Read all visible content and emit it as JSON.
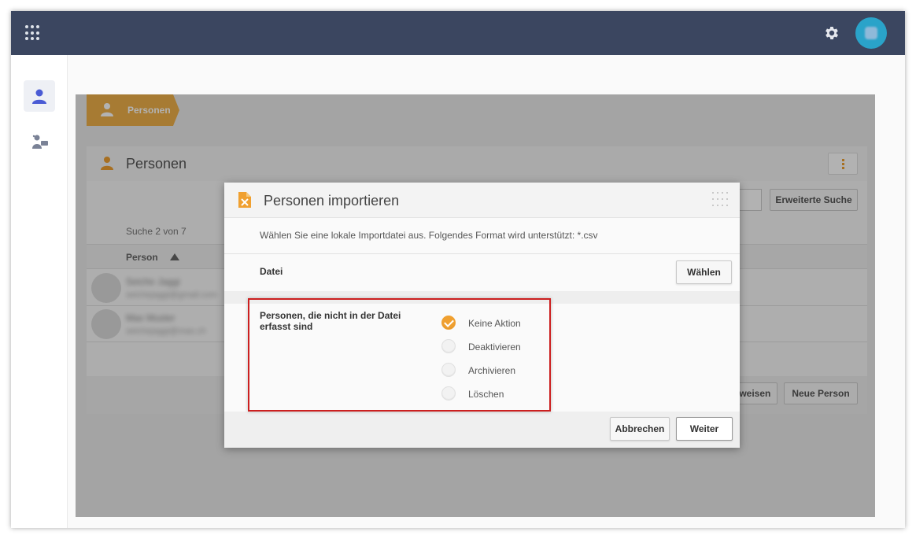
{
  "topbar": {
    "apps_icon": "apps-grid-icon",
    "settings_icon": "gear-icon",
    "avatar": "user-avatar"
  },
  "sidebar": {
    "items": [
      {
        "name": "persons",
        "icon": "person-icon",
        "active": true
      },
      {
        "name": "assignments",
        "icon": "person-chat-icon",
        "active": false
      }
    ]
  },
  "breadcrumb": {
    "label": "Personen"
  },
  "panel": {
    "title": "Personen",
    "advanced_search_label": "Erweiterte Suche",
    "search_count": "Suche 2 von 7",
    "column_person": "Person",
    "rows": [
      {
        "name": "Seiche Jaggi",
        "email": "seichejaggi@gmail.com"
      },
      {
        "name": "Max Muster",
        "email": "seichejaggi@mas.ch"
      }
    ],
    "assign_label": "Zuweisen",
    "new_person_label": "Neue Person"
  },
  "modal": {
    "title": "Personen importieren",
    "description": "Wählen Sie eine lokale Importdatei aus. Folgendes Format wird unterstützt: *.csv",
    "file_label": "Datei",
    "choose_label": "Wählen",
    "option_group_label": "Personen, die nicht in der Datei erfasst sind",
    "options": [
      {
        "label": "Keine Aktion",
        "checked": true
      },
      {
        "label": "Deaktivieren",
        "checked": false
      },
      {
        "label": "Archivieren",
        "checked": false
      },
      {
        "label": "Löschen",
        "checked": false
      }
    ],
    "cancel_label": "Abbrechen",
    "next_label": "Weiter"
  },
  "colors": {
    "topbar": "#3b4660",
    "accent": "#f0a030",
    "avatar": "#2aa3c9",
    "highlight": "#cc1f1f"
  }
}
